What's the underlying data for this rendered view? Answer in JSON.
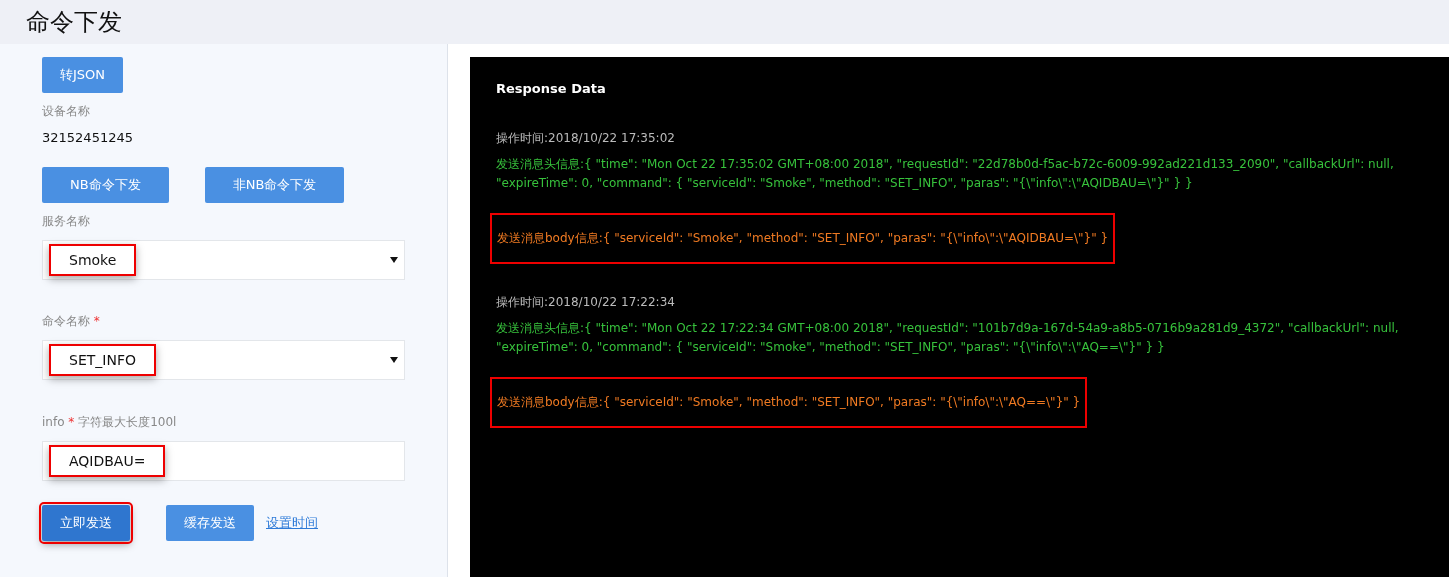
{
  "page": {
    "title": "命令下发"
  },
  "form": {
    "to_json_button": "转JSON",
    "device_name": {
      "label": "设备名称",
      "value": "32152451245"
    },
    "mode_buttons": [
      "NB命令下发",
      "非NB命令下发"
    ],
    "service": {
      "label": "服务名称",
      "value": "Smoke",
      "highlighted": true
    },
    "command": {
      "label": "命令名称",
      "required": true,
      "required_mark": "*",
      "value": "SET_INFO",
      "highlighted": true
    },
    "info": {
      "label": "info",
      "required": true,
      "required_mark": "*",
      "hint": "字符最大长度100l",
      "value": "AQIDBAU=",
      "highlighted": true
    },
    "actions": [
      {
        "kind": "button",
        "label": "立即发送",
        "highlighted": true
      },
      {
        "kind": "button",
        "label": "缓存发送",
        "highlighted": false
      },
      {
        "kind": "link",
        "label": "设置时间",
        "highlighted": false
      }
    ]
  },
  "response": {
    "title": "Response Data",
    "entries": [
      {
        "time": "操作时间:2018/10/22 17:35:02",
        "header": "发送消息头信息:{ \"time\": \"Mon Oct 22 17:35:02 GMT+08:00 2018\", \"requestId\": \"22d78b0d-f5ac-b72c-6009-992ad221d133_2090\", \"callbackUrl\": null, \"expireTime\": 0, \"command\": { \"serviceId\": \"Smoke\", \"method\": \"SET_INFO\", \"paras\": \"{\\\"info\\\":\\\"AQIDBAU=\\\"}\" } }",
        "body": "发送消息body信息:{ \"serviceId\": \"Smoke\", \"method\": \"SET_INFO\", \"paras\": \"{\\\"info\\\":\\\"AQIDBAU=\\\"}\" }",
        "highlighted": true
      },
      {
        "time": "操作时间:2018/10/22 17:22:34",
        "header": "发送消息头信息:{ \"time\": \"Mon Oct 22 17:22:34 GMT+08:00 2018\", \"requestId\": \"101b7d9a-167d-54a9-a8b5-0716b9a281d9_4372\", \"callbackUrl\": null, \"expireTime\": 0, \"command\": { \"serviceId\": \"Smoke\", \"method\": \"SET_INFO\", \"paras\": \"{\\\"info\\\":\\\"AQ==\\\"}\" } }",
        "body": "发送消息body信息:{ \"serviceId\": \"Smoke\", \"method\": \"SET_INFO\", \"paras\": \"{\\\"info\\\":\\\"AQ==\\\"}\" }",
        "highlighted": true
      }
    ]
  }
}
